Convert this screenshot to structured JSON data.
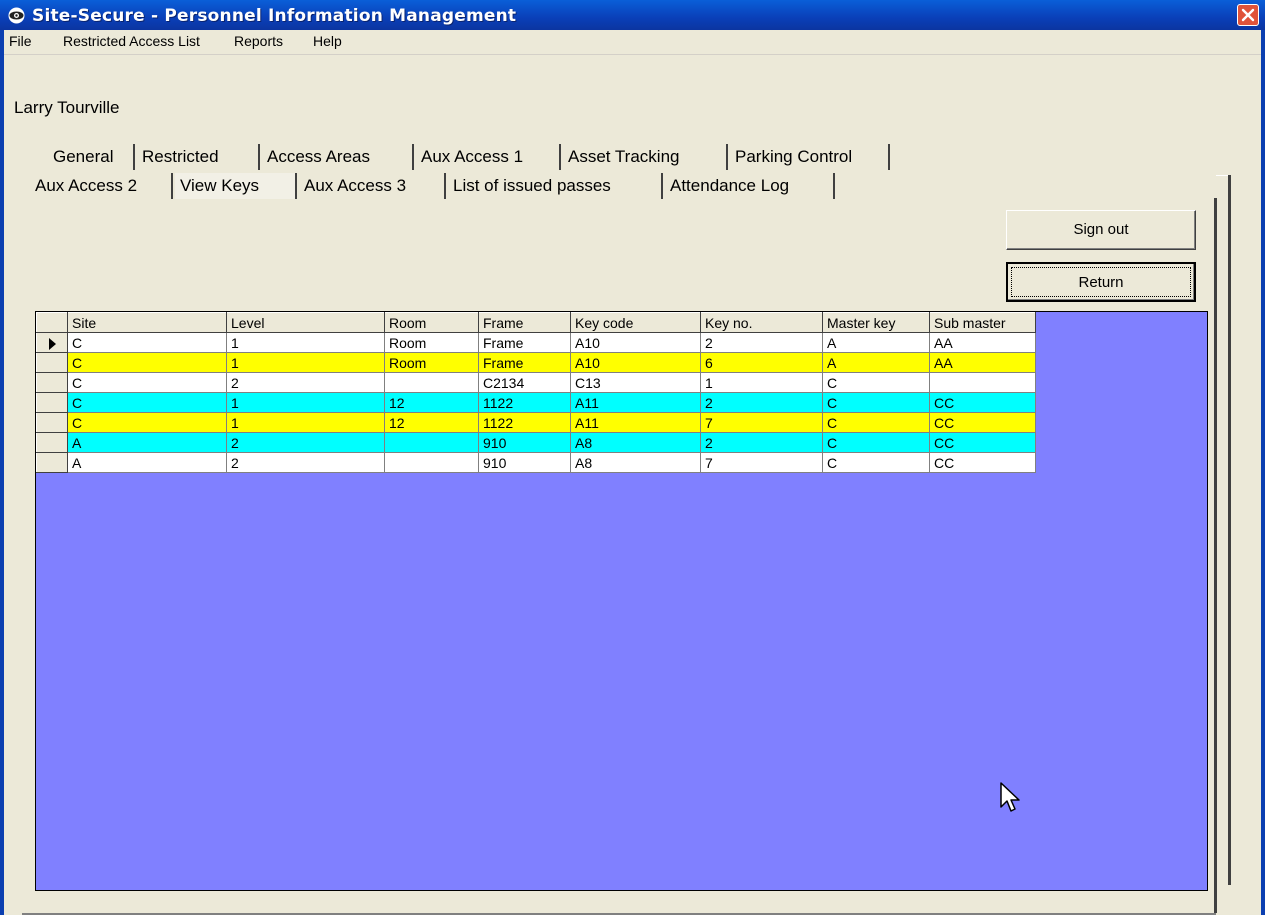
{
  "window": {
    "title": "Site-Secure - Personnel Information Management"
  },
  "menu": [
    "File",
    "Restricted Access List",
    "Reports",
    "Help"
  ],
  "user": {
    "name": "Larry Tourville"
  },
  "tabs_row1": [
    "General",
    "Restricted",
    "Access Areas",
    "Aux Access 1",
    "Asset Tracking",
    "Parking Control"
  ],
  "tabs_row2": [
    "Aux Access 2",
    "View Keys",
    "Aux Access 3",
    "List of issued passes",
    "Attendance Log"
  ],
  "active_tab": "View Keys",
  "buttons": {
    "sign_out": "Sign out",
    "return": "Return"
  },
  "grid": {
    "columns": [
      "Site",
      "Level",
      "Room",
      "Frame",
      "Key code",
      "Key no.",
      "Master key",
      "Sub master"
    ],
    "rows": [
      {
        "color": "white",
        "current": true,
        "cells": [
          "C",
          "1",
          "Room",
          "Frame",
          "A10",
          "2",
          "A",
          "AA"
        ]
      },
      {
        "color": "yellow",
        "current": false,
        "cells": [
          "C",
          "1",
          "Room",
          "Frame",
          "A10",
          "6",
          "A",
          "AA"
        ]
      },
      {
        "color": "white",
        "current": false,
        "cells": [
          "C",
          "2",
          "",
          "C2134",
          "C13",
          "1",
          "C",
          ""
        ]
      },
      {
        "color": "cyan",
        "current": false,
        "cells": [
          "C",
          "1",
          "12",
          "1122",
          "A11",
          "2",
          "C",
          "CC"
        ]
      },
      {
        "color": "yellow",
        "current": false,
        "cells": [
          "C",
          "1",
          "12",
          "1122",
          "A11",
          "7",
          "C",
          "CC"
        ]
      },
      {
        "color": "cyan",
        "current": false,
        "cells": [
          "A",
          "2",
          "",
          "910",
          "A8",
          "2",
          "C",
          "CC"
        ]
      },
      {
        "color": "white",
        "current": false,
        "cells": [
          "A",
          "2",
          "",
          "910",
          "A8",
          "7",
          "C",
          "CC"
        ]
      }
    ]
  },
  "colors": {
    "grid_background": "#8080ff",
    "highlight_yellow": "#ffff00",
    "highlight_cyan": "#00ffff",
    "titlebar": "#0a4fc8"
  },
  "icons": {
    "app": "eye-icon",
    "close": "close-icon",
    "row_pointer": "row-pointer-icon",
    "cursor": "mouse-pointer-icon"
  }
}
